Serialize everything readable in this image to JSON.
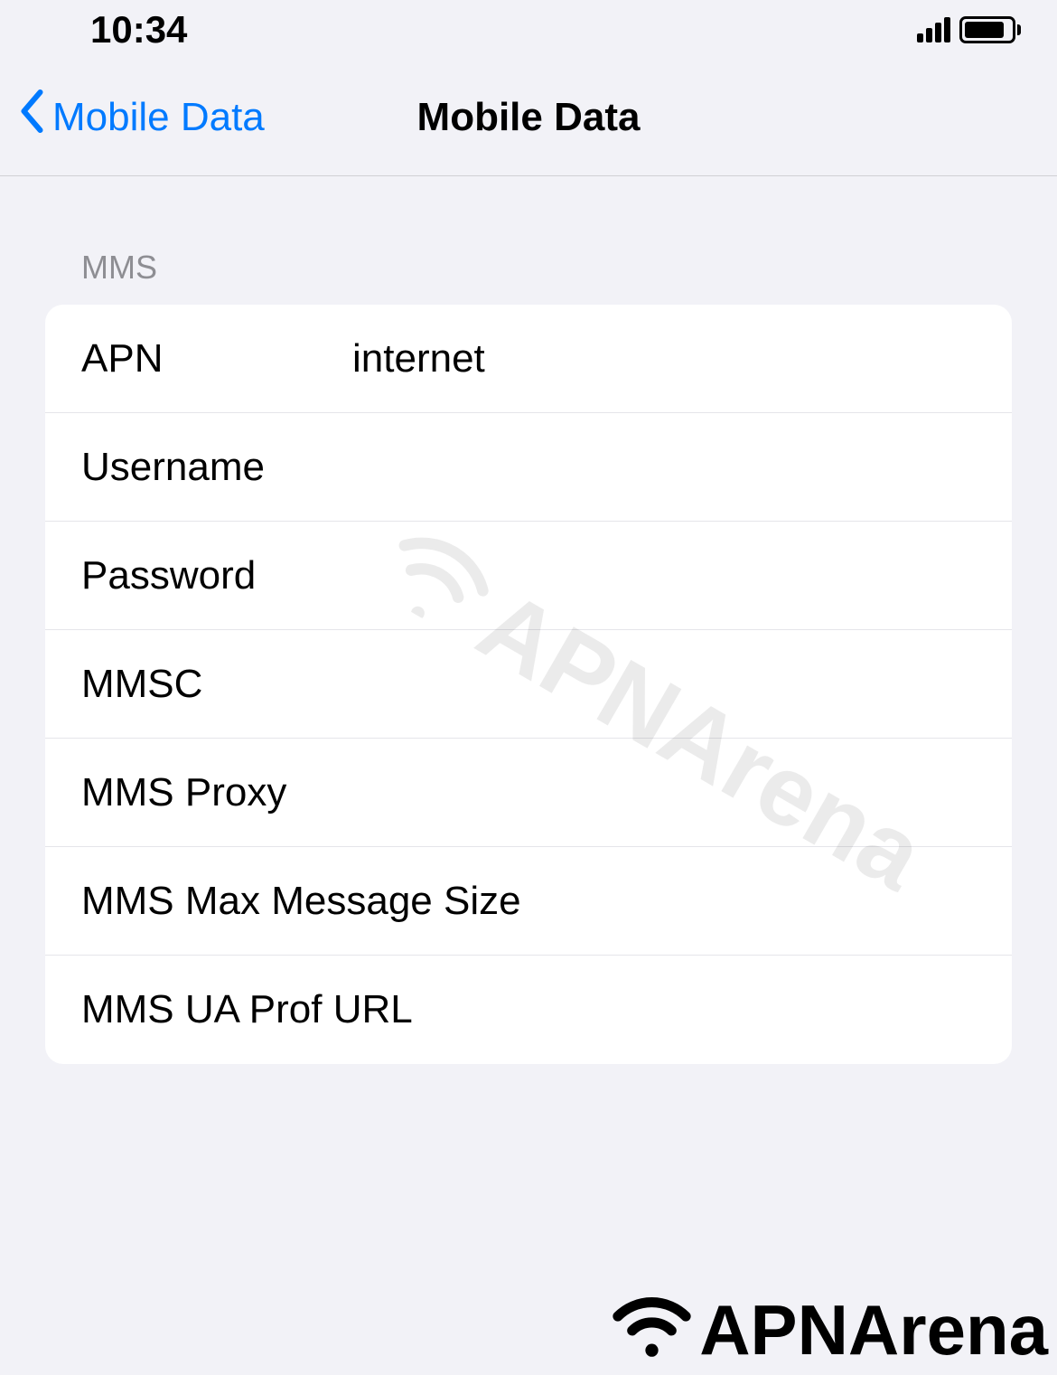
{
  "status_bar": {
    "time": "10:34"
  },
  "nav": {
    "back_label": "Mobile Data",
    "title": "Mobile Data"
  },
  "section": {
    "header": "MMS",
    "rows": [
      {
        "label": "APN",
        "value": "internet"
      },
      {
        "label": "Username",
        "value": ""
      },
      {
        "label": "Password",
        "value": ""
      },
      {
        "label": "MMSC",
        "value": ""
      },
      {
        "label": "MMS Proxy",
        "value": ""
      },
      {
        "label": "MMS Max Message Size",
        "value": ""
      },
      {
        "label": "MMS UA Prof URL",
        "value": ""
      }
    ]
  },
  "watermark": "APNArena",
  "footer_logo": "APNArena"
}
